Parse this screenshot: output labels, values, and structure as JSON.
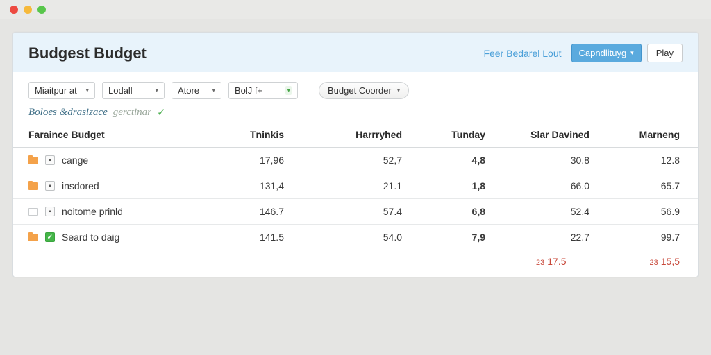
{
  "header": {
    "title": "Budgest Budget",
    "link": "Feer Bedarel Lout",
    "primary_btn": "Capndlituyg",
    "secondary_btn": "Play"
  },
  "filters": {
    "f1": "Miaitpur at",
    "f2": "Lodall",
    "f3": "Atore",
    "f4": "BolJ f+",
    "f5": "Budget Coorder"
  },
  "status": {
    "main": "Boloes &drasizace",
    "sub": "gerctinar"
  },
  "columns": {
    "c0": "Faraince Budget",
    "c1": "Tninkis",
    "c2": "Harrryhed",
    "c3": "Tunday",
    "c4": "Slar Davined",
    "c5": "Marneng"
  },
  "rows": [
    {
      "folder": true,
      "mark": "dot",
      "name": "cange",
      "v1": "17,96",
      "v2": "52,7",
      "v3": "4,8",
      "v4": "30.8",
      "v5": "12.8"
    },
    {
      "folder": true,
      "mark": "dot",
      "name": "insdored",
      "v1": "131,4",
      "v2": "21.1",
      "v3": "1,8",
      "v4": "66.0",
      "v5": "65.7"
    },
    {
      "folder": false,
      "mark": "dot",
      "name": "noitome prinld",
      "v1": "146.7",
      "v2": "57.4",
      "v3": "6,8",
      "v4": "52,4",
      "v5": "56.9"
    },
    {
      "folder": true,
      "mark": "check",
      "name": "Seard to daig",
      "v1": "141.5",
      "v2": "54.0",
      "v3": "7,9",
      "v4": "22.7",
      "v5": "99.7"
    }
  ],
  "totals": {
    "t4_pre": "23",
    "t4_val": "17.5",
    "t5_pre": "23",
    "t5_val": "15,5"
  }
}
